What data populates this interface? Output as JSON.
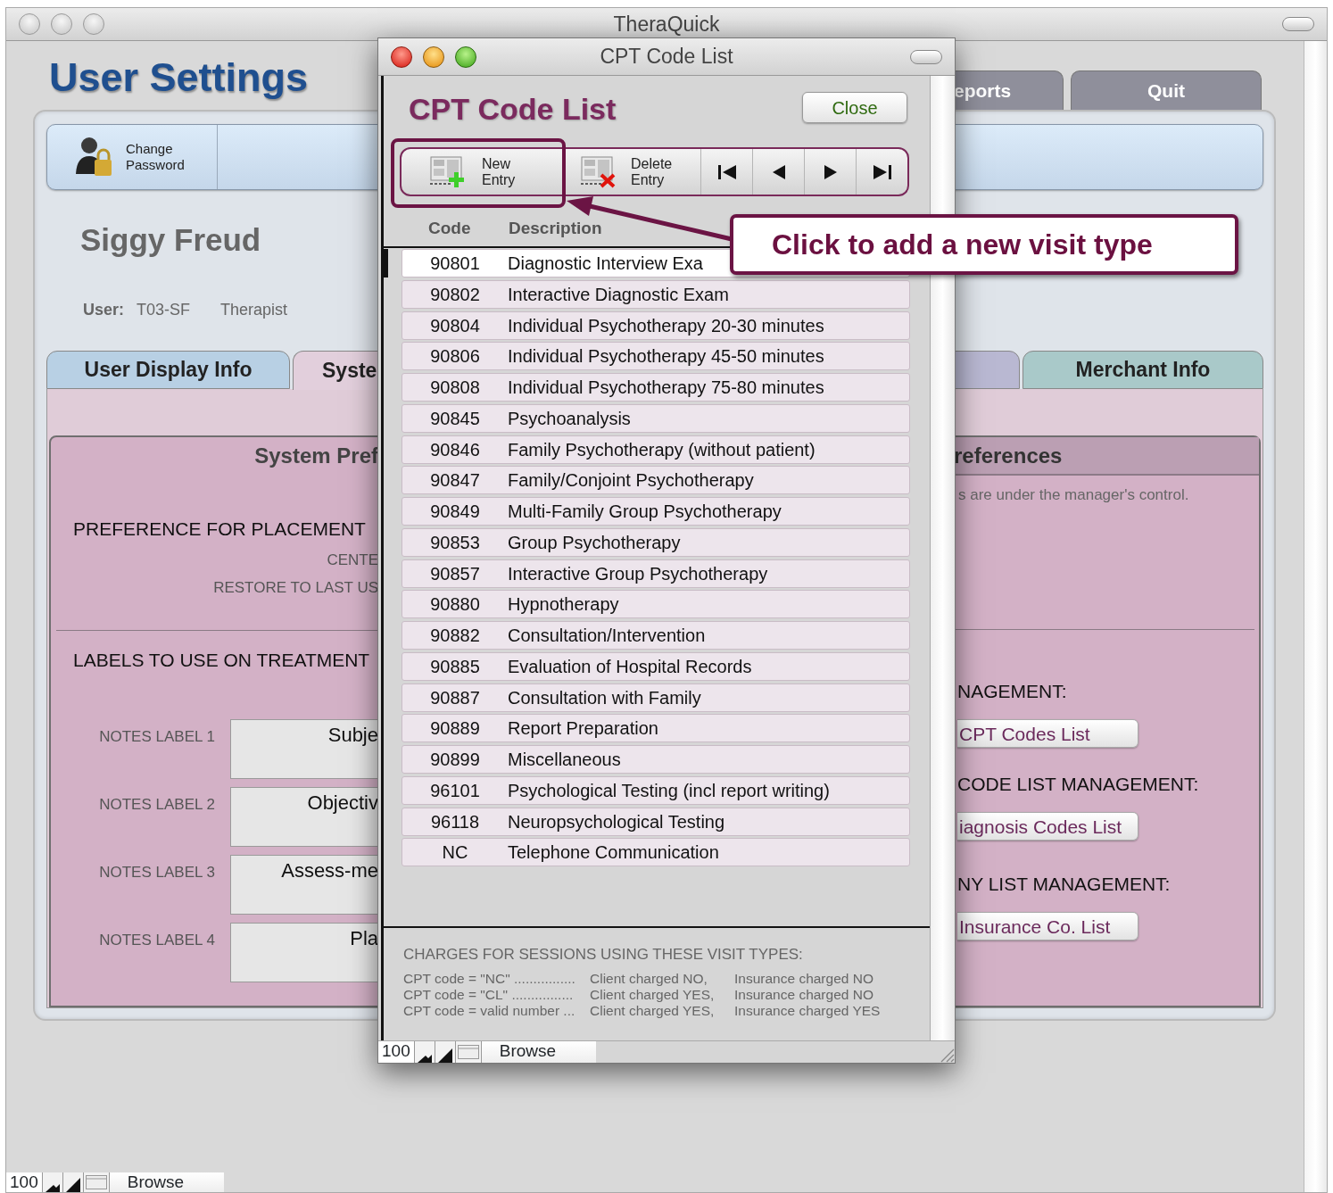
{
  "main_window": {
    "title": "TheraQuick",
    "heading": "User Settings",
    "top_tabs": [
      {
        "label": "eports"
      },
      {
        "label": "Quit"
      }
    ],
    "toolbar": [
      {
        "label": "Change Password"
      }
    ],
    "user": {
      "name": "Siggy Freud",
      "label": "User:",
      "id": "T03-SF",
      "role": "Therapist"
    },
    "tabs": [
      {
        "label": "User Display Info",
        "selected": false,
        "color": "#b8d0e4"
      },
      {
        "label": "Syste",
        "selected": true,
        "color": "#e2cfdc"
      },
      {
        "selected": false,
        "color": "#b9b8d2"
      },
      {
        "label": "Merchant Info",
        "selected": false,
        "color": "#a9c9c9"
      }
    ],
    "left_panel": {
      "header": "System Pref",
      "placement_title": "PREFERENCE FOR PLACEMENT",
      "placement_options": [
        "CENTE",
        "RESTORE TO LAST US"
      ],
      "labels_title": "LABELS TO USE ON TREATMENT",
      "notes_labels": [
        {
          "label": "NOTES LABEL 1",
          "value": "Subje"
        },
        {
          "label": "NOTES LABEL 2",
          "value": "Objectiv"
        },
        {
          "label": "NOTES LABEL 3",
          "value": "Assess-me"
        },
        {
          "label": "NOTES LABEL 4",
          "value": "Pla"
        }
      ]
    },
    "right_panel": {
      "header": "references",
      "note": "s are under the manager's control.",
      "managements": [
        {
          "title": "NAGEMENT:",
          "button": "CPT Codes List"
        },
        {
          "title": "CODE LIST MANAGEMENT:",
          "button": "iagnosis Codes List"
        },
        {
          "title": "NY LIST MANAGEMENT:",
          "button": "Insurance Co. List"
        }
      ]
    },
    "status_bar": {
      "zoom": "100",
      "mode": "Browse"
    }
  },
  "dialog": {
    "title": "CPT Code List",
    "heading": "CPT Code List",
    "close": "Close",
    "toolbar": [
      {
        "kind": "new",
        "label": "New Entry"
      },
      {
        "kind": "delete",
        "label": "Delete Entry"
      },
      {
        "kind": "first"
      },
      {
        "kind": "prev"
      },
      {
        "kind": "next"
      },
      {
        "kind": "last"
      }
    ],
    "columns": [
      "Code",
      "Description"
    ],
    "rows": [
      {
        "code": "90801",
        "description": "Diagnostic Interview Exa",
        "selected": true
      },
      {
        "code": "90802",
        "description": "Interactive Diagnostic Exam",
        "selected": false
      },
      {
        "code": "90804",
        "description": "Individual Psychotherapy 20-30 minutes",
        "selected": false
      },
      {
        "code": "90806",
        "description": "Individual Psychotherapy 45-50 minutes",
        "selected": false
      },
      {
        "code": "90808",
        "description": "Individual Psychotherapy 75-80 minutes",
        "selected": false
      },
      {
        "code": "90845",
        "description": "Psychoanalysis",
        "selected": false
      },
      {
        "code": "90846",
        "description": "Family Psychotherapy (without patient)",
        "selected": false
      },
      {
        "code": "90847",
        "description": "Family/Conjoint Psychotherapy",
        "selected": false
      },
      {
        "code": "90849",
        "description": "Multi-Family Group Psychotherapy",
        "selected": false
      },
      {
        "code": "90853",
        "description": "Group Psychotherapy",
        "selected": false
      },
      {
        "code": "90857",
        "description": "Interactive Group Psychotherapy",
        "selected": false
      },
      {
        "code": "90880",
        "description": "Hypnotherapy",
        "selected": false
      },
      {
        "code": "90882",
        "description": "Consultation/Intervention",
        "selected": false
      },
      {
        "code": "90885",
        "description": "Evaluation of Hospital Records",
        "selected": false
      },
      {
        "code": "90887",
        "description": "Consultation with Family",
        "selected": false
      },
      {
        "code": "90889",
        "description": "Report Preparation",
        "selected": false
      },
      {
        "code": "90899",
        "description": "Miscellaneous",
        "selected": false
      },
      {
        "code": "96101",
        "description": "Psychological Testing (incl report writing)",
        "selected": false
      },
      {
        "code": "96118",
        "description": "Neuropsychological Testing",
        "selected": false
      },
      {
        "code": "NC",
        "description": "Telephone Communication",
        "selected": false
      }
    ],
    "notes": {
      "title": "CHARGES FOR SESSIONS USING THESE VISIT TYPES:",
      "lines": [
        {
          "rule": "CPT code = \"NC\" ................",
          "client": "Client charged NO,",
          "insurance": "Insurance charged NO"
        },
        {
          "rule": "CPT code = \"CL\" ................",
          "client": "Client charged YES,",
          "insurance": "Insurance charged NO"
        },
        {
          "rule": "CPT code = valid number ...",
          "client": "Client charged YES,",
          "insurance": "Insurance charged YES"
        }
      ]
    },
    "status_bar": {
      "zoom": "100",
      "mode": "Browse"
    }
  },
  "callout": {
    "text": "Click to add a new visit type"
  }
}
